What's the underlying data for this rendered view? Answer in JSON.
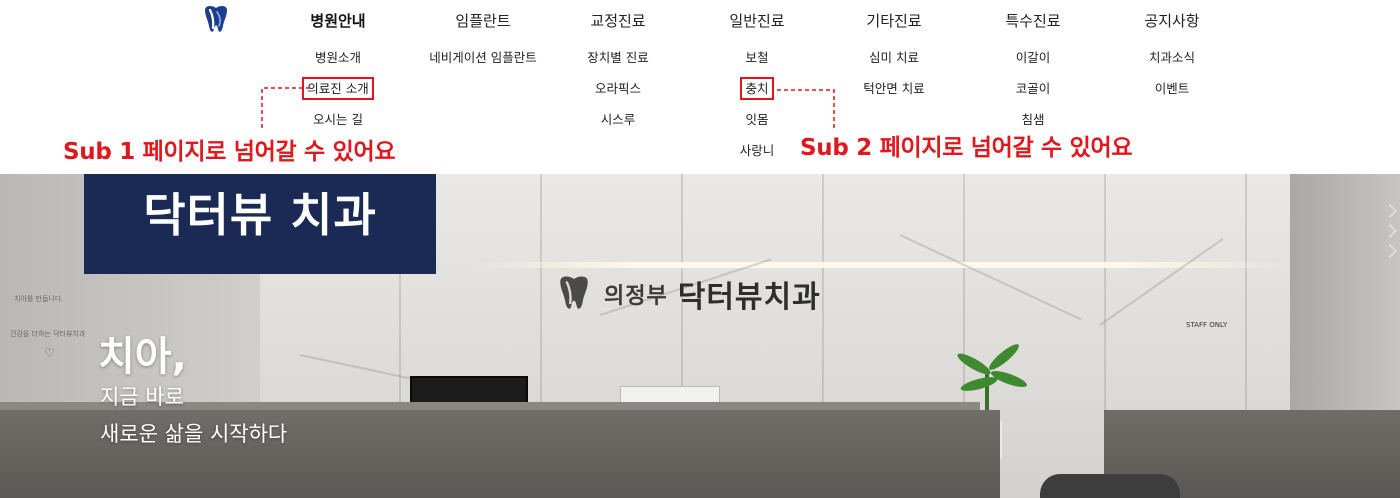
{
  "header": {
    "logo_name": "tooth-logo",
    "menu": [
      {
        "label": "병원안내",
        "active": true,
        "items": [
          "병원소개",
          "의료진 소개",
          "오시는 길"
        ]
      },
      {
        "label": "임플란트",
        "items": [
          "네비게이션 임플란트"
        ]
      },
      {
        "label": "교정진료",
        "items": [
          "장치별 진료",
          "오라픽스",
          "시스루"
        ]
      },
      {
        "label": "일반진료",
        "items": [
          "보철",
          "충치",
          "잇몸",
          "사랑니"
        ]
      },
      {
        "label": "기타진료",
        "items": [
          "심미 치료",
          "턱안면 치료"
        ]
      },
      {
        "label": "특수진료",
        "items": [
          "이갈이",
          "코골이",
          "침샘"
        ]
      },
      {
        "label": "공지사항",
        "items": [
          "치과소식",
          "이벤트"
        ]
      }
    ]
  },
  "annotations": {
    "note1": "Sub 1 페이지로 넘어갈 수 있어요",
    "note2": "Sub 2 페이지로 넘어갈 수 있어요",
    "color": "#e1171e"
  },
  "hero": {
    "title": "닥터뷰 치과",
    "sign_small": "의정부",
    "sign_big": "닥터뷰치과",
    "headline": "치아,",
    "line2": "지금 바로",
    "line3": "새로운 삶을 시작하다",
    "staff_sign": "STAFF ONLY",
    "title_bg": "#1b2a55"
  }
}
